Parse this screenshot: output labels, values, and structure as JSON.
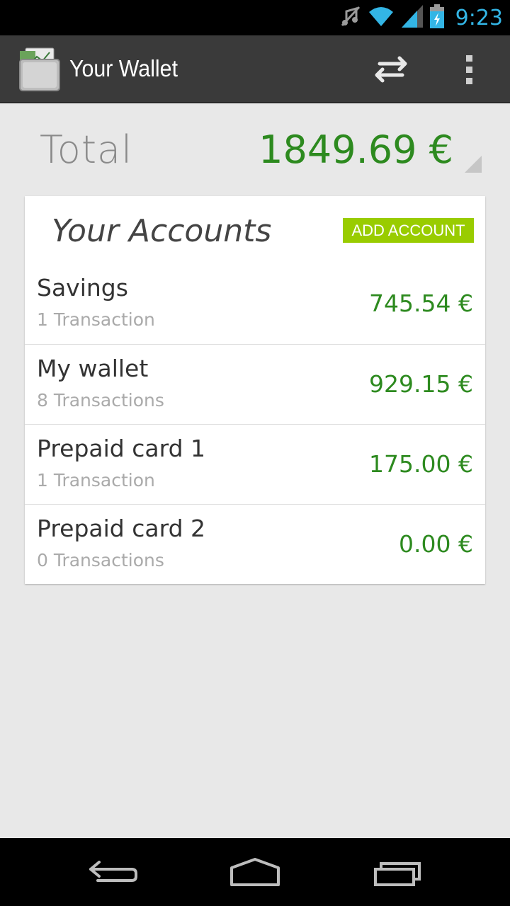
{
  "status_bar": {
    "time": "9:23",
    "icons": [
      "mute-icon",
      "wifi-icon",
      "signal-icon",
      "battery-charging-icon"
    ]
  },
  "action_bar": {
    "title": "Your Wallet",
    "icons": [
      "wallet-app-icon",
      "transfer-icon",
      "overflow-menu-icon"
    ]
  },
  "total": {
    "label": "Total",
    "value": "1849.69 €"
  },
  "accounts": {
    "title": "Your Accounts",
    "add_button": "ADD ACCOUNT",
    "items": [
      {
        "name": "Savings",
        "transactions": "1 Transaction",
        "balance": "745.54 €"
      },
      {
        "name": "My wallet",
        "transactions": "8 Transactions",
        "balance": "929.15 €"
      },
      {
        "name": "Prepaid card 1",
        "transactions": "1 Transaction",
        "balance": "175.00 €"
      },
      {
        "name": "Prepaid card 2",
        "transactions": "0 Transactions",
        "balance": "0.00 €"
      }
    ]
  },
  "nav_bar": {
    "icons": [
      "back-icon",
      "home-icon",
      "recent-apps-icon"
    ]
  },
  "colors": {
    "accent_green": "#2d8a1f",
    "button_green": "#99cc00",
    "status_blue": "#33b5e5"
  }
}
